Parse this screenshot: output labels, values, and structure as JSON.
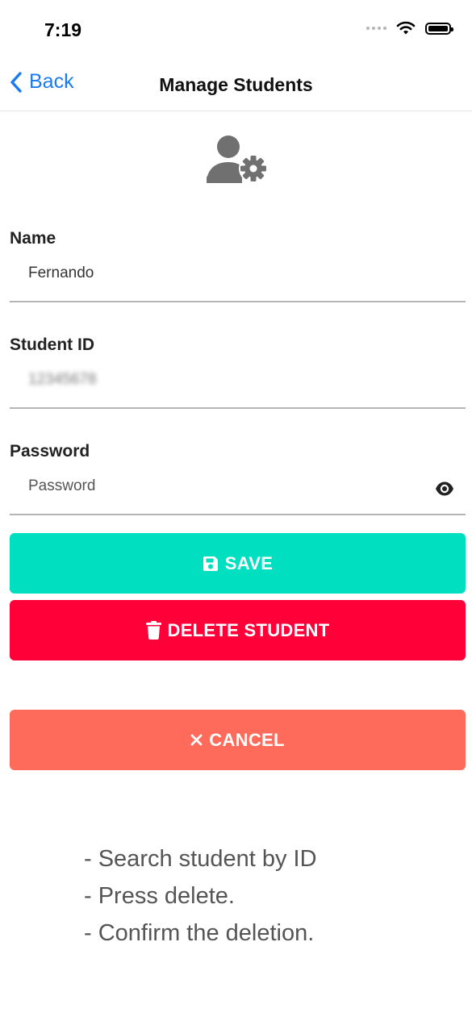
{
  "status_bar": {
    "time": "7:19"
  },
  "nav": {
    "back_label": "Back",
    "title": "Manage Students"
  },
  "form": {
    "name_label": "Name",
    "name_value": "Fernando",
    "student_id_label": "Student ID",
    "student_id_value": "12345678",
    "password_label": "Password",
    "password_placeholder": "Password"
  },
  "buttons": {
    "save": "SAVE",
    "delete": "DELETE STUDENT",
    "cancel": "CANCEL"
  },
  "instructions": [
    "- Search student by ID",
    "- Press delete.",
    "- Confirm the deletion."
  ],
  "colors": {
    "save": "#00dfc0",
    "delete": "#ff0038",
    "cancel": "#ff6b5b",
    "link": "#1a7bf0"
  },
  "icons": [
    "signal-icon",
    "wifi-icon",
    "battery-icon",
    "back-chevron-icon",
    "user-settings-icon",
    "eye-icon",
    "save-icon",
    "trash-icon",
    "close-icon"
  ]
}
